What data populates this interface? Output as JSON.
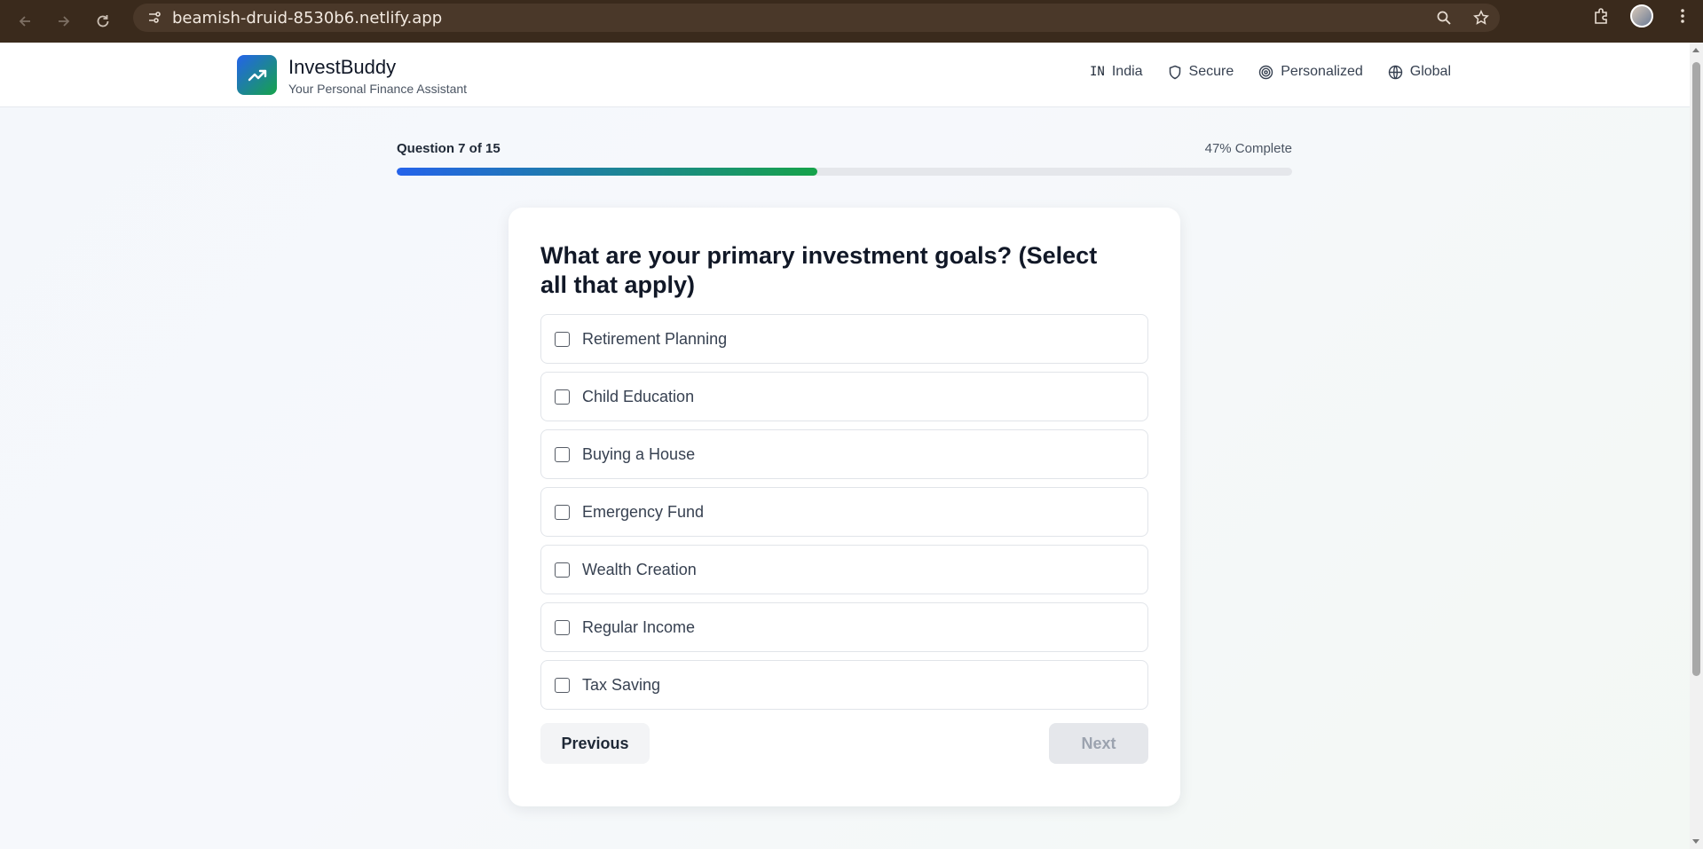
{
  "browser": {
    "url": "beamish-druid-8530b6.netlify.app"
  },
  "header": {
    "brand_name": "InvestBuddy",
    "brand_tagline": "Your Personal Finance Assistant",
    "badges": {
      "country_flag": "IN",
      "country": "India",
      "secure": "Secure",
      "personalized": "Personalized",
      "global": "Global"
    }
  },
  "progress": {
    "label": "Question 7 of 15",
    "percent_text": "47% Complete",
    "percent": 47
  },
  "question": {
    "text": "What are your primary investment goals? (Select all that apply)",
    "options": [
      {
        "label": "Retirement Planning",
        "checked": false
      },
      {
        "label": "Child Education",
        "checked": false
      },
      {
        "label": "Buying a House",
        "checked": false
      },
      {
        "label": "Emergency Fund",
        "checked": false
      },
      {
        "label": "Wealth Creation",
        "checked": false
      },
      {
        "label": "Regular Income",
        "checked": false
      },
      {
        "label": "Tax Saving",
        "checked": false
      }
    ]
  },
  "buttons": {
    "previous": "Previous",
    "next": "Next",
    "next_disabled": true
  },
  "colors": {
    "brand_blue": "#2563eb",
    "brand_green": "#16a34a",
    "browser_bar": "#3a2a1c"
  }
}
